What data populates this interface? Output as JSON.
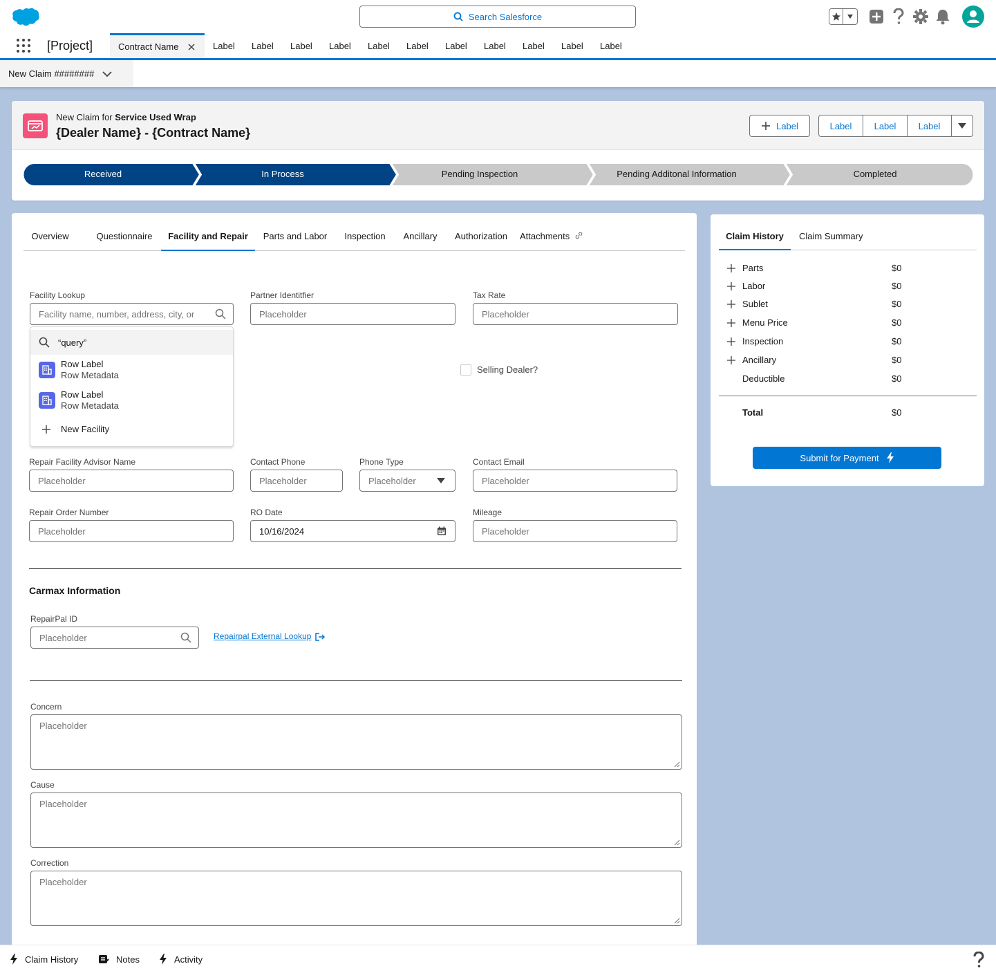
{
  "header": {
    "search_placeholder": "Search Salesforce"
  },
  "nav": {
    "app_name": "[Project]",
    "active_tab": "Contract Name",
    "tabs": [
      "Label",
      "Label",
      "Label",
      "Label",
      "Label",
      "Label",
      "Label",
      "Label",
      "Label",
      "Label",
      "Label"
    ]
  },
  "subtab": {
    "label": "New Claim ########"
  },
  "record": {
    "subtitle_prefix": "New Claim for ",
    "subtitle_bold": "Service Used Wrap",
    "title": "{Dealer Name} - {Contract Name}",
    "new_button": "Label",
    "group_buttons": [
      "Label",
      "Label",
      "Label"
    ]
  },
  "path": {
    "stages": [
      "Received",
      "In Process",
      "Pending Inspection",
      "Pending Additonal Information",
      "Completed"
    ],
    "completed_count": 2
  },
  "tabs": [
    "Overview",
    "Questionnaire",
    "Facility  and Repair",
    "Parts and Labor",
    "Inspection",
    "Ancillary",
    "Authorization",
    "Attachments"
  ],
  "form": {
    "facility_lookup": {
      "label": "Facility Lookup",
      "placeholder": "Facility name, number, address, city, or"
    },
    "partner_id": {
      "label": "Partner Identitfier",
      "placeholder": "Placeholder"
    },
    "tax_rate": {
      "label": "Tax Rate",
      "placeholder": "Placeholder"
    },
    "dropdown": {
      "query": "“query”",
      "rows": [
        {
          "label": "Row Label",
          "meta": "Row Metadata"
        },
        {
          "label": "Row Label",
          "meta": "Row Metadata"
        }
      ],
      "new_label": "New Facility"
    },
    "selling_dealer": "Selling Dealer?",
    "advisor": {
      "label": "Repair Facility Advisor Name",
      "placeholder": "Placeholder"
    },
    "contact_phone": {
      "label": "Contact Phone",
      "placeholder": "Placeholder"
    },
    "phone_type": {
      "label": "Phone Type",
      "placeholder": "Placeholder"
    },
    "contact_email": {
      "label": "Contact Email",
      "placeholder": "Placeholder"
    },
    "repair_order": {
      "label": "Repair Order Number",
      "placeholder": "Placeholder"
    },
    "ro_date": {
      "label": "RO Date",
      "value": "10/16/2024"
    },
    "mileage": {
      "label": "Mileage",
      "placeholder": "Placeholder"
    },
    "carmax_title": "Carmax Information",
    "repairpal": {
      "label": "RepairPal ID",
      "placeholder": "Placeholder"
    },
    "repairpal_link": "Repairpal External Lookup",
    "concern": {
      "label": "Concern",
      "placeholder": "Placeholder"
    },
    "cause": {
      "label": "Cause",
      "placeholder": "Placeholder"
    },
    "correction": {
      "label": "Correction",
      "placeholder": "Placeholder"
    }
  },
  "side": {
    "tabs": [
      "Claim History",
      "Claim Summary"
    ],
    "rows": [
      {
        "name": "Parts",
        "amount": "$0"
      },
      {
        "name": "Labor",
        "amount": "$0"
      },
      {
        "name": "Sublet",
        "amount": "$0"
      },
      {
        "name": "Menu Price",
        "amount": "$0"
      },
      {
        "name": "Inspection",
        "amount": "$0"
      },
      {
        "name": "Ancillary",
        "amount": "$0"
      },
      {
        "name": "Deductible",
        "amount": "$0"
      }
    ],
    "total_label": "Total",
    "total_amount": "$0",
    "submit": "Submit for Payment"
  },
  "utility": {
    "items": [
      "Claim History",
      "Notes",
      "Activity"
    ]
  },
  "colors": {
    "brand": "#0176d3",
    "path_complete": "#014486",
    "path_incomplete": "#c9c9c9",
    "record_icon": "#f4517b",
    "lookup_icon": "#5867e8",
    "background": "#b0c4df"
  }
}
